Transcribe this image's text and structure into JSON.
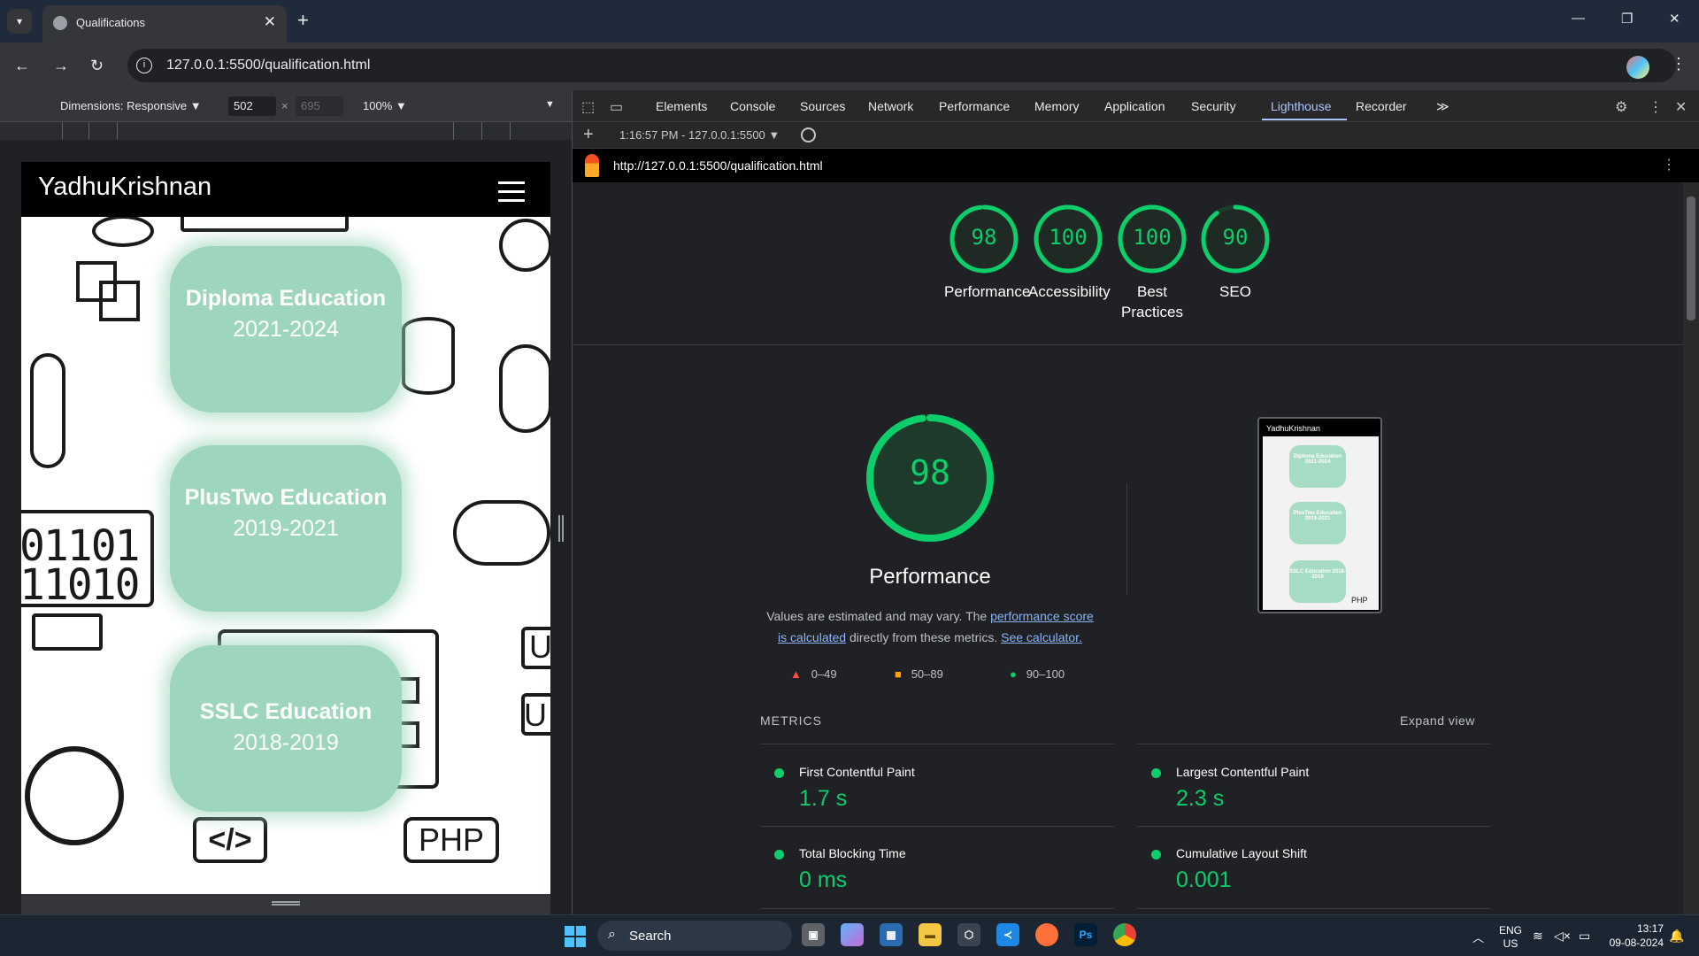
{
  "browser": {
    "tab_title": "Qualifications",
    "url": "127.0.0.1:5500/qualification.html"
  },
  "device_toolbar": {
    "dimensions_label": "Dimensions: Responsive",
    "width": "502",
    "times": "×",
    "height": "695",
    "zoom": "100%"
  },
  "page": {
    "brand": "YadhuKrishnan",
    "cards": [
      {
        "title": "Diploma Education",
        "years": "2021-2024"
      },
      {
        "title": "PlusTwo Education",
        "years": "2019-2021"
      },
      {
        "title": "SSLC Education",
        "years": "2018-2019"
      }
    ],
    "doodle_text": {
      "binary1": "01101",
      "binary2": "11010",
      "code_tag": "</>",
      "php": "PHP",
      "u1": "U",
      "u2": "U"
    }
  },
  "devtools": {
    "tabs": [
      "Elements",
      "Console",
      "Sources",
      "Network",
      "Performance",
      "Memory",
      "Application",
      "Security",
      "Lighthouse",
      "Recorder"
    ],
    "active_tab": "Lighthouse",
    "run_label": "1:16:57 PM - 127.0.0.1:5500",
    "report_url": "http://127.0.0.1:5500/qualification.html"
  },
  "lighthouse": {
    "scores": [
      {
        "label": "Performance",
        "value": "98",
        "score": 0.98
      },
      {
        "label": "Accessibility",
        "value": "100",
        "score": 1.0
      },
      {
        "label": "Best Practices",
        "value": "100",
        "score": 1.0
      },
      {
        "label": "SEO",
        "value": "90",
        "score": 0.9
      }
    ],
    "main_score": "98",
    "main_title": "Performance",
    "desc_prefix": "Values are estimated and may vary. The ",
    "desc_link1": "performance score is calculated",
    "desc_middle": " directly from these metrics. ",
    "desc_link2": "See calculator.",
    "legend": [
      "0–49",
      "50–89",
      "90–100"
    ],
    "metrics_label": "METRICS",
    "expand_label": "Expand view",
    "metrics": [
      {
        "name": "First Contentful Paint",
        "value": "1.7 s"
      },
      {
        "name": "Largest Contentful Paint",
        "value": "2.3 s"
      },
      {
        "name": "Total Blocking Time",
        "value": "0 ms"
      },
      {
        "name": "Cumulative Layout Shift",
        "value": "0.001"
      }
    ],
    "thumb": {
      "title": "YadhuKrishnan",
      "cards": [
        "Diploma Education 2021-2024",
        "PlusTwo Education 2019-2021",
        "SSLC Education 2018-2019"
      ],
      "php": "PHP"
    }
  },
  "colors": {
    "good": "#0cce6b",
    "average": "#ffa400",
    "fail": "#ff4e42",
    "card": "#9ed6bd"
  },
  "taskbar": {
    "search": "Search",
    "lang1": "ENG",
    "lang2": "US",
    "time": "13:17",
    "date": "09-08-2024"
  }
}
